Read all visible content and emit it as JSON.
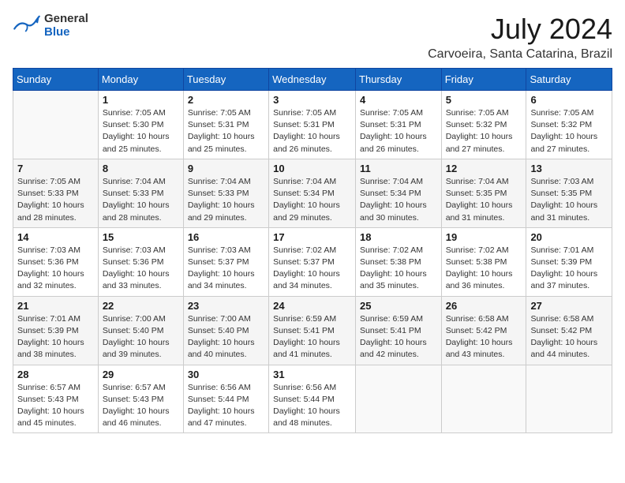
{
  "header": {
    "logo_general": "General",
    "logo_blue": "Blue",
    "month_year": "July 2024",
    "location": "Carvoeira, Santa Catarina, Brazil"
  },
  "weekdays": [
    "Sunday",
    "Monday",
    "Tuesday",
    "Wednesday",
    "Thursday",
    "Friday",
    "Saturday"
  ],
  "weeks": [
    [
      {
        "day": "",
        "empty": true
      },
      {
        "day": "1",
        "sunrise": "7:05 AM",
        "sunset": "5:30 PM",
        "daylight": "10 hours and 25 minutes."
      },
      {
        "day": "2",
        "sunrise": "7:05 AM",
        "sunset": "5:31 PM",
        "daylight": "10 hours and 25 minutes."
      },
      {
        "day": "3",
        "sunrise": "7:05 AM",
        "sunset": "5:31 PM",
        "daylight": "10 hours and 26 minutes."
      },
      {
        "day": "4",
        "sunrise": "7:05 AM",
        "sunset": "5:31 PM",
        "daylight": "10 hours and 26 minutes."
      },
      {
        "day": "5",
        "sunrise": "7:05 AM",
        "sunset": "5:32 PM",
        "daylight": "10 hours and 27 minutes."
      },
      {
        "day": "6",
        "sunrise": "7:05 AM",
        "sunset": "5:32 PM",
        "daylight": "10 hours and 27 minutes."
      }
    ],
    [
      {
        "day": "7",
        "sunrise": "7:05 AM",
        "sunset": "5:33 PM",
        "daylight": "10 hours and 28 minutes."
      },
      {
        "day": "8",
        "sunrise": "7:04 AM",
        "sunset": "5:33 PM",
        "daylight": "10 hours and 28 minutes."
      },
      {
        "day": "9",
        "sunrise": "7:04 AM",
        "sunset": "5:33 PM",
        "daylight": "10 hours and 29 minutes."
      },
      {
        "day": "10",
        "sunrise": "7:04 AM",
        "sunset": "5:34 PM",
        "daylight": "10 hours and 29 minutes."
      },
      {
        "day": "11",
        "sunrise": "7:04 AM",
        "sunset": "5:34 PM",
        "daylight": "10 hours and 30 minutes."
      },
      {
        "day": "12",
        "sunrise": "7:04 AM",
        "sunset": "5:35 PM",
        "daylight": "10 hours and 31 minutes."
      },
      {
        "day": "13",
        "sunrise": "7:03 AM",
        "sunset": "5:35 PM",
        "daylight": "10 hours and 31 minutes."
      }
    ],
    [
      {
        "day": "14",
        "sunrise": "7:03 AM",
        "sunset": "5:36 PM",
        "daylight": "10 hours and 32 minutes."
      },
      {
        "day": "15",
        "sunrise": "7:03 AM",
        "sunset": "5:36 PM",
        "daylight": "10 hours and 33 minutes."
      },
      {
        "day": "16",
        "sunrise": "7:03 AM",
        "sunset": "5:37 PM",
        "daylight": "10 hours and 34 minutes."
      },
      {
        "day": "17",
        "sunrise": "7:02 AM",
        "sunset": "5:37 PM",
        "daylight": "10 hours and 34 minutes."
      },
      {
        "day": "18",
        "sunrise": "7:02 AM",
        "sunset": "5:38 PM",
        "daylight": "10 hours and 35 minutes."
      },
      {
        "day": "19",
        "sunrise": "7:02 AM",
        "sunset": "5:38 PM",
        "daylight": "10 hours and 36 minutes."
      },
      {
        "day": "20",
        "sunrise": "7:01 AM",
        "sunset": "5:39 PM",
        "daylight": "10 hours and 37 minutes."
      }
    ],
    [
      {
        "day": "21",
        "sunrise": "7:01 AM",
        "sunset": "5:39 PM",
        "daylight": "10 hours and 38 minutes."
      },
      {
        "day": "22",
        "sunrise": "7:00 AM",
        "sunset": "5:40 PM",
        "daylight": "10 hours and 39 minutes."
      },
      {
        "day": "23",
        "sunrise": "7:00 AM",
        "sunset": "5:40 PM",
        "daylight": "10 hours and 40 minutes."
      },
      {
        "day": "24",
        "sunrise": "6:59 AM",
        "sunset": "5:41 PM",
        "daylight": "10 hours and 41 minutes."
      },
      {
        "day": "25",
        "sunrise": "6:59 AM",
        "sunset": "5:41 PM",
        "daylight": "10 hours and 42 minutes."
      },
      {
        "day": "26",
        "sunrise": "6:58 AM",
        "sunset": "5:42 PM",
        "daylight": "10 hours and 43 minutes."
      },
      {
        "day": "27",
        "sunrise": "6:58 AM",
        "sunset": "5:42 PM",
        "daylight": "10 hours and 44 minutes."
      }
    ],
    [
      {
        "day": "28",
        "sunrise": "6:57 AM",
        "sunset": "5:43 PM",
        "daylight": "10 hours and 45 minutes."
      },
      {
        "day": "29",
        "sunrise": "6:57 AM",
        "sunset": "5:43 PM",
        "daylight": "10 hours and 46 minutes."
      },
      {
        "day": "30",
        "sunrise": "6:56 AM",
        "sunset": "5:44 PM",
        "daylight": "10 hours and 47 minutes."
      },
      {
        "day": "31",
        "sunrise": "6:56 AM",
        "sunset": "5:44 PM",
        "daylight": "10 hours and 48 minutes."
      },
      {
        "day": "",
        "empty": true
      },
      {
        "day": "",
        "empty": true
      },
      {
        "day": "",
        "empty": true
      }
    ]
  ],
  "labels": {
    "sunrise": "Sunrise:",
    "sunset": "Sunset:",
    "daylight": "Daylight:"
  }
}
